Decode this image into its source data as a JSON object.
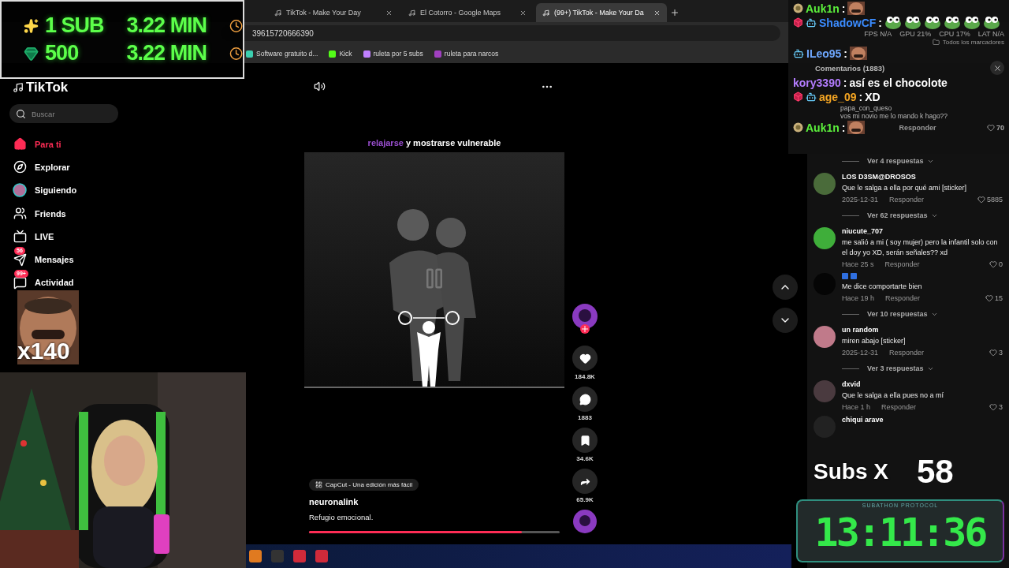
{
  "browser": {
    "tabs": [
      {
        "title": "TikTok - Make Your Day",
        "selected": false
      },
      {
        "title": "El Cotorro - Google Maps",
        "selected": false
      },
      {
        "title": "(99+) TikTok - Make Your Da",
        "selected": true
      }
    ],
    "address": "39615720666390",
    "bookmarks": [
      "Software gratuito d...",
      "Kick",
      "ruleta por 5 subs",
      "ruleta para narcos"
    ],
    "all_bookmarks": "Todos los marcadores"
  },
  "goal_overlay": {
    "rows": [
      {
        "kind": "sub",
        "amount": "1 SUB",
        "time": "3.22 MIN"
      },
      {
        "kind": "gem",
        "amount": "500",
        "time": "3.22 MIN"
      }
    ]
  },
  "sidebar": {
    "logo": "TikTok",
    "search": {
      "placeholder": "Buscar"
    },
    "items": [
      {
        "label": "Para ti",
        "kind": "home",
        "selected": true
      },
      {
        "label": "Explorar",
        "kind": "compass",
        "selected": false
      },
      {
        "label": "Siguiendo",
        "kind": "avatar",
        "selected": false
      },
      {
        "label": "Friends",
        "kind": "friends",
        "selected": false
      },
      {
        "label": "LIVE",
        "kind": "live",
        "selected": false
      },
      {
        "label": "Mensajes",
        "kind": "messages",
        "badge": "56",
        "selected": false
      },
      {
        "label": "Actividad",
        "kind": "activity",
        "badge": "99+",
        "selected": false
      }
    ]
  },
  "meme_overlay": {
    "count": "x140"
  },
  "video": {
    "caption_highlight": "relajarse",
    "caption_rest": "y mostrarse vulnerable",
    "stats": [
      {
        "kind": "like",
        "count": "184.8K"
      },
      {
        "kind": "comment",
        "count": "1883"
      },
      {
        "kind": "bookmark",
        "count": "34.6K"
      },
      {
        "kind": "share",
        "count": "65.9K"
      }
    ],
    "app_tag": "CapCut - Una edición más fácil",
    "author": "neuronalink",
    "description": "Refugio emocional.",
    "progress": {
      "level": 0.85
    }
  },
  "obs_stats": [
    {
      "label": "FPS",
      "value": "N/A"
    },
    {
      "label": "GPU",
      "value": "21%"
    },
    {
      "label": "CPU",
      "value": "17%"
    },
    {
      "label": "LAT",
      "value": "N/A"
    }
  ],
  "chat": [
    {
      "user": "Auk1n",
      "separator": ":",
      "color": "#5cf03c",
      "badges": [
        {
          "kind": "coin"
        }
      ],
      "emotes": [
        {
          "kind": "meme"
        }
      ]
    },
    {
      "user": "ShadowCF",
      "separator": ":",
      "color": "#3b8cff",
      "badges": [
        {
          "kind": "cube"
        },
        {
          "kind": "bot"
        }
      ],
      "emotes": [
        {
          "kind": "frog"
        },
        {
          "kind": "frog"
        },
        {
          "kind": "frog"
        },
        {
          "kind": "frog"
        },
        {
          "kind": "frog"
        },
        {
          "kind": "frog"
        }
      ]
    },
    {
      "user": "ILeo95",
      "separator": ":",
      "color": "#6fa8ff",
      "badges": [
        {
          "kind": "bot"
        }
      ],
      "emotes": [
        {
          "kind": "meme"
        }
      ]
    },
    {
      "user": "kory3390",
      "separator": ":",
      "color": "#b47dff",
      "message": "así es el chocolote"
    },
    {
      "user": "age_09",
      "separator": ":",
      "color": "#f5a623",
      "badges": [
        {
          "kind": "cube"
        },
        {
          "kind": "bot"
        }
      ],
      "message": "XD"
    },
    {
      "user": "Auk1n",
      "separator": ":",
      "color": "#5cf03c",
      "badges": [
        {
          "kind": "coin"
        }
      ],
      "emotes": [
        {
          "kind": "meme"
        }
      ]
    }
  ],
  "comments": {
    "title": "Comentarios (1883)",
    "top_comment": {
      "author": "papa_con_queso",
      "text": "vos mi novio me lo mando k hago??",
      "reply": "Responder",
      "likes": "70"
    },
    "items": [
      {
        "kind": "replies",
        "label": "Ver 4 respuestas"
      },
      {
        "kind": "comment",
        "author": "LOS D3SM@DROSOS",
        "color": "#4a6b3a",
        "text": "Que le salga a ella por qué ami [sticker]",
        "date": "2025-12-31",
        "reply": "Responder",
        "likes": "5885"
      },
      {
        "kind": "replies",
        "label": "Ver 62 respuestas"
      },
      {
        "kind": "comment",
        "author": "niucute_707",
        "color": "#3fae3a",
        "text": "me salió a mi ( soy mujer) pero la infantil solo con el doy yo XD, serán señales?? xd",
        "date": "Hace 25 s",
        "reply": "Responder",
        "likes": "0"
      },
      {
        "kind": "comment",
        "color": "#050505",
        "text": "Me dice comportarte bien",
        "date": "Hace 19 h",
        "reply": "Responder",
        "likes": "15"
      },
      {
        "kind": "replies",
        "label": "Ver 10 respuestas"
      },
      {
        "kind": "comment",
        "author": "un random",
        "color": "#c07a8a",
        "text": "miren abajo [sticker]",
        "date": "2025-12-31",
        "reply": "Responder",
        "likes": "3"
      },
      {
        "kind": "replies",
        "label": "Ver 3 respuestas"
      },
      {
        "kind": "comment",
        "author": "dxvid",
        "color": "#4a3a3f",
        "text": "Que le salga a ella pues no a mí",
        "date": "Hace 1 h",
        "reply": "Responder",
        "likes": "3"
      },
      {
        "kind": "comment",
        "author": "chiqui arave",
        "color": "#222222"
      }
    ]
  },
  "subs_counter": {
    "label": "Subs X",
    "count": "58"
  },
  "timer": {
    "title": "SUBATHON PROTOCOL",
    "time": "13:11:36"
  }
}
